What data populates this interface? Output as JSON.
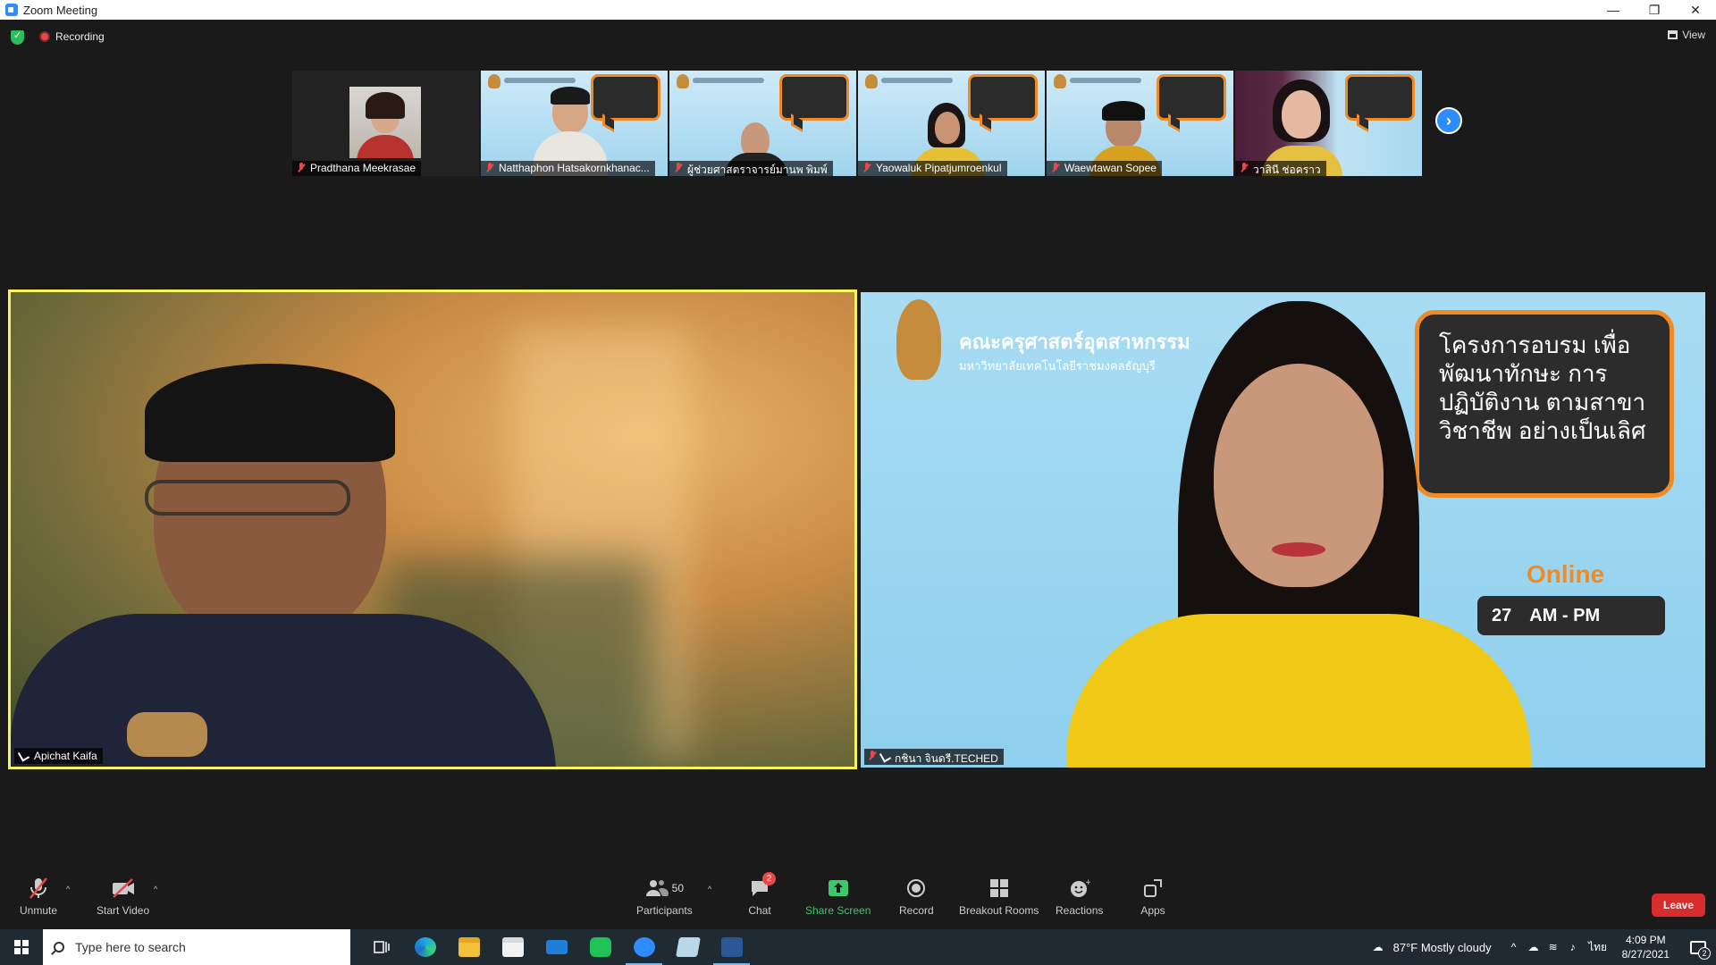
{
  "window": {
    "title": "Zoom Meeting",
    "minimize": "—",
    "restore": "❐",
    "close": "✕"
  },
  "topbar": {
    "recording_label": "Recording",
    "view_label": "View"
  },
  "thumbnails": [
    {
      "name": "Pradthana Meekrasae"
    },
    {
      "name": "Natthaphon Hatsakornkhanac..."
    },
    {
      "name": "ผู้ช่วยศาสตราจารย์มานพ พิมพ์"
    },
    {
      "name": "Yaowaluk Pipatjumroenkul"
    },
    {
      "name": "Waewtawan Sopee"
    },
    {
      "name": "วาสินี ช่อคราว"
    }
  ],
  "next_page_icon": "›",
  "main_videos": [
    {
      "name": "Apichat Kaifa"
    },
    {
      "name": "กชินา  จินดรี.TECHED"
    }
  ],
  "slide": {
    "org_line1": "คณะครุศาสตร์อุตสาหกรรม",
    "org_line2": "มหาวิทยาลัยเทคโนโลยีราชมงคลธัญบุรี",
    "board_text": "โครงการอบรม เพื่อพัฒนาทักษะ การปฏิบัติงาน ตามสาขาวิชาชีพ อย่างเป็นเลิศ",
    "online": "Online",
    "date_text": "27",
    "time_text": "AM - PM"
  },
  "toolbar": {
    "unmute": "Unmute",
    "start_video": "Start Video",
    "participants": "Participants",
    "participants_count": "50",
    "chat": "Chat",
    "chat_badge": "2",
    "share_screen": "Share Screen",
    "record": "Record",
    "breakout_rooms": "Breakout Rooms",
    "reactions": "Reactions",
    "apps": "Apps",
    "leave": "Leave"
  },
  "taskbar": {
    "search_placeholder": "Type here to search",
    "weather": "87°F  Mostly cloudy",
    "lang": "ไทย",
    "time": "4:09 PM",
    "date": "8/27/2021",
    "notifications": "2"
  },
  "colors": {
    "zoom_blue": "#2d8cff",
    "active_speaker": "#f5f55a",
    "leave_red": "#d92d2d",
    "share_green": "#3cc96b"
  }
}
